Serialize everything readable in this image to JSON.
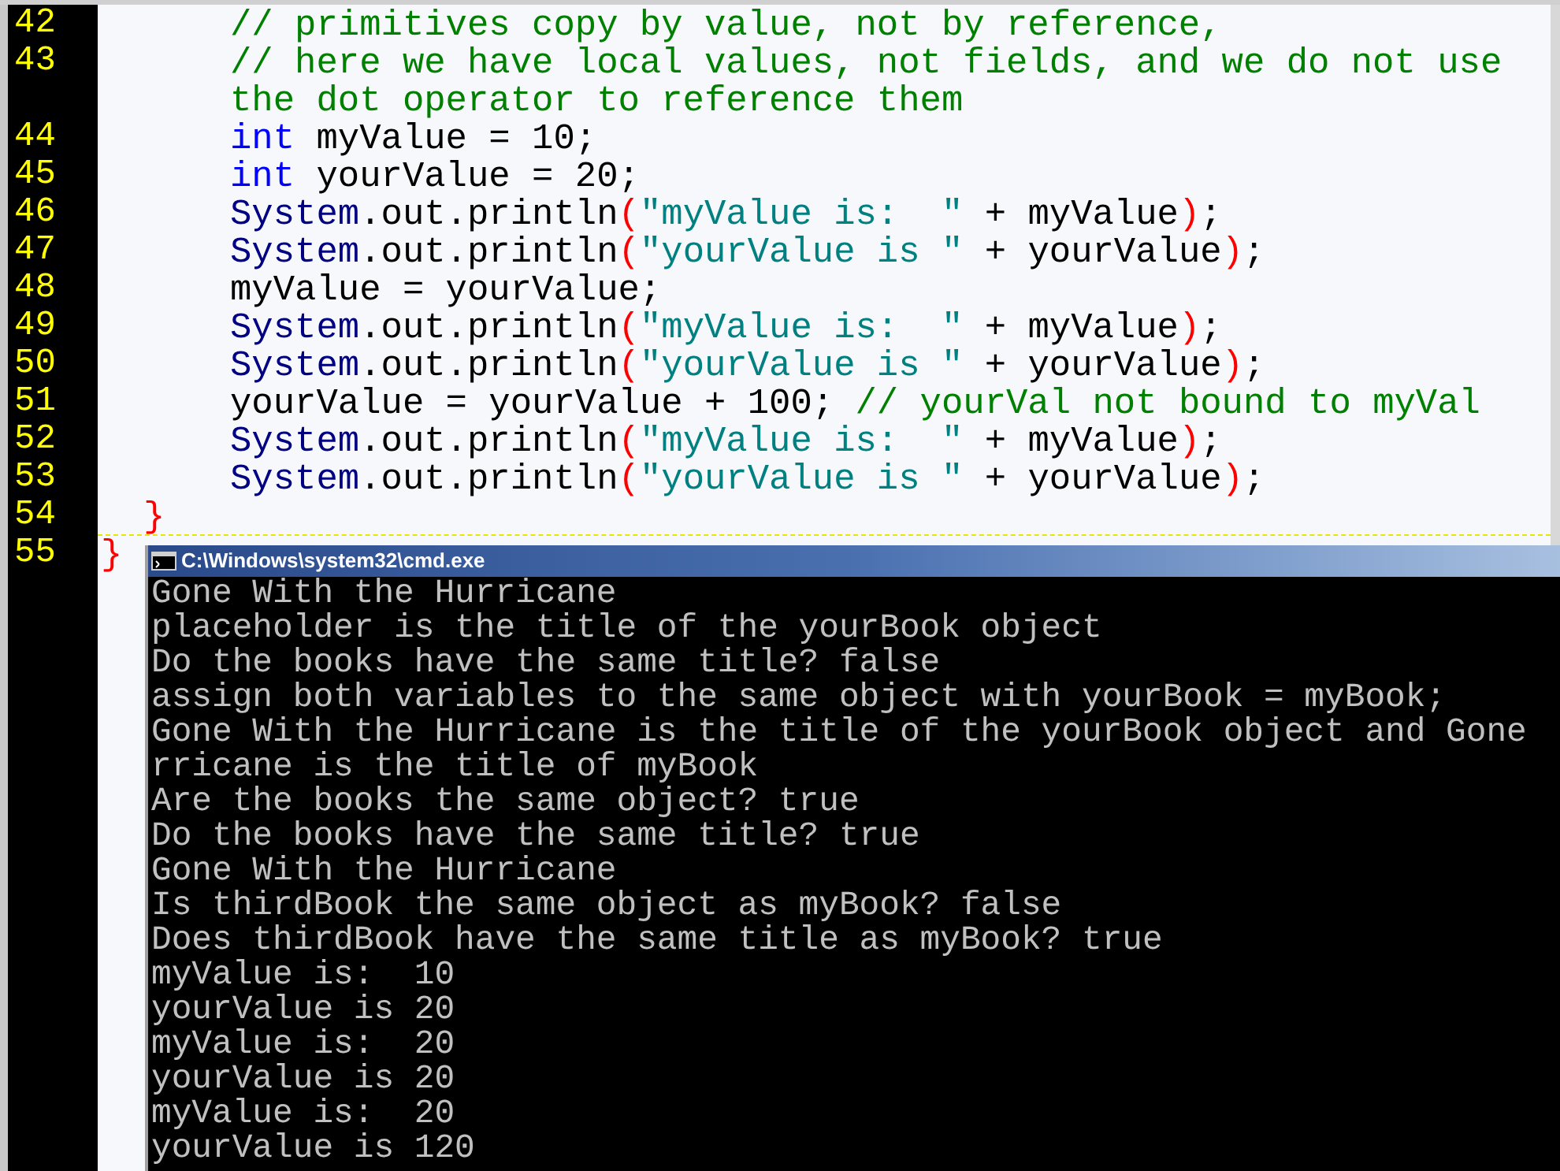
{
  "editor": {
    "lines": [
      {
        "number": "42",
        "kind": "body",
        "current": false,
        "tokens": [
          {
            "kind": "comment",
            "text": "// primitives copy by value, not by reference,"
          }
        ]
      },
      {
        "number": "43",
        "kind": "body",
        "current": false,
        "tokens": [
          {
            "kind": "comment",
            "text": "// here we have local values, not fields, and we do not use"
          }
        ]
      },
      {
        "kind": "body",
        "current": false,
        "tokens": [
          {
            "kind": "comment",
            "text": "the dot operator to reference them"
          }
        ]
      },
      {
        "number": "44",
        "kind": "body",
        "current": false,
        "tokens": [
          {
            "kind": "keyword",
            "text": "int"
          },
          {
            "kind": "plain",
            "text": " myValue = 10;"
          }
        ]
      },
      {
        "number": "45",
        "kind": "body",
        "current": false,
        "tokens": [
          {
            "kind": "keyword",
            "text": "int"
          },
          {
            "kind": "plain",
            "text": " yourValue = 20;"
          }
        ]
      },
      {
        "number": "46",
        "kind": "body",
        "current": false,
        "tokens": [
          {
            "kind": "class",
            "text": "System"
          },
          {
            "kind": "plain",
            "text": ".out.println"
          },
          {
            "kind": "paren",
            "text": "("
          },
          {
            "kind": "string",
            "text": "\"myValue is:  \""
          },
          {
            "kind": "plain",
            "text": " + myValue"
          },
          {
            "kind": "paren",
            "text": ")"
          },
          {
            "kind": "plain",
            "text": ";"
          }
        ]
      },
      {
        "number": "47",
        "kind": "body",
        "current": false,
        "tokens": [
          {
            "kind": "class",
            "text": "System"
          },
          {
            "kind": "plain",
            "text": ".out.println"
          },
          {
            "kind": "paren",
            "text": "("
          },
          {
            "kind": "string",
            "text": "\"yourValue is \""
          },
          {
            "kind": "plain",
            "text": " + yourValue"
          },
          {
            "kind": "paren",
            "text": ")"
          },
          {
            "kind": "plain",
            "text": ";"
          }
        ]
      },
      {
        "number": "48",
        "kind": "body",
        "current": false,
        "tokens": [
          {
            "kind": "plain",
            "text": "myValue = yourValue;"
          }
        ]
      },
      {
        "number": "49",
        "kind": "body",
        "current": false,
        "tokens": [
          {
            "kind": "class",
            "text": "System"
          },
          {
            "kind": "plain",
            "text": ".out.println"
          },
          {
            "kind": "paren",
            "text": "("
          },
          {
            "kind": "string",
            "text": "\"myValue is:  \""
          },
          {
            "kind": "plain",
            "text": " + myValue"
          },
          {
            "kind": "paren",
            "text": ")"
          },
          {
            "kind": "plain",
            "text": ";"
          }
        ]
      },
      {
        "number": "50",
        "kind": "body",
        "current": false,
        "tokens": [
          {
            "kind": "class",
            "text": "System"
          },
          {
            "kind": "plain",
            "text": ".out.println"
          },
          {
            "kind": "paren",
            "text": "("
          },
          {
            "kind": "string",
            "text": "\"yourValue is \""
          },
          {
            "kind": "plain",
            "text": " + yourValue"
          },
          {
            "kind": "paren",
            "text": ")"
          },
          {
            "kind": "plain",
            "text": ";"
          }
        ]
      },
      {
        "number": "51",
        "kind": "body",
        "current": false,
        "tokens": [
          {
            "kind": "plain",
            "text": "yourValue = yourValue + 100; "
          },
          {
            "kind": "comment",
            "text": "// yourVal not bound to myVal"
          }
        ]
      },
      {
        "number": "52",
        "kind": "body",
        "current": false,
        "tokens": [
          {
            "kind": "class",
            "text": "System"
          },
          {
            "kind": "plain",
            "text": ".out.println"
          },
          {
            "kind": "paren",
            "text": "("
          },
          {
            "kind": "string",
            "text": "\"myValue is:  \""
          },
          {
            "kind": "plain",
            "text": " + myValue"
          },
          {
            "kind": "paren",
            "text": ")"
          },
          {
            "kind": "plain",
            "text": ";"
          }
        ]
      },
      {
        "number": "53",
        "kind": "body",
        "current": false,
        "tokens": [
          {
            "kind": "class",
            "text": "System"
          },
          {
            "kind": "plain",
            "text": ".out.println"
          },
          {
            "kind": "paren",
            "text": "("
          },
          {
            "kind": "string",
            "text": "\"yourValue is \""
          },
          {
            "kind": "plain",
            "text": " + yourValue"
          },
          {
            "kind": "paren",
            "text": ")"
          },
          {
            "kind": "plain",
            "text": ";"
          }
        ]
      },
      {
        "number": "54",
        "kind": "method_end",
        "current": false,
        "tokens": [
          {
            "kind": "paren",
            "text": "}"
          }
        ]
      },
      {
        "number": "55",
        "kind": "class_end",
        "current": true,
        "tokens": [
          {
            "kind": "paren",
            "text": "}"
          }
        ]
      }
    ]
  },
  "console": {
    "title": "C:\\Windows\\system32\\cmd.exe",
    "lines": [
      "Gone With the Hurricane",
      "placeholder is the title of the yourBook object",
      "Do the books have the same title? false",
      "assign both variables to the same object with yourBook = myBook;",
      "Gone With the Hurricane is the title of the yourBook object and Gone",
      "rricane is the title of myBook",
      "Are the books the same object? true",
      "Do the books have the same title? true",
      "Gone With the Hurricane",
      "Is thirdBook the same object as myBook? false",
      "Does thirdBook have the same title as myBook? true",
      "myValue is:  10",
      "yourValue is 20",
      "myValue is:  20",
      "yourValue is 20",
      "myValue is:  20",
      "yourValue is 120"
    ]
  }
}
